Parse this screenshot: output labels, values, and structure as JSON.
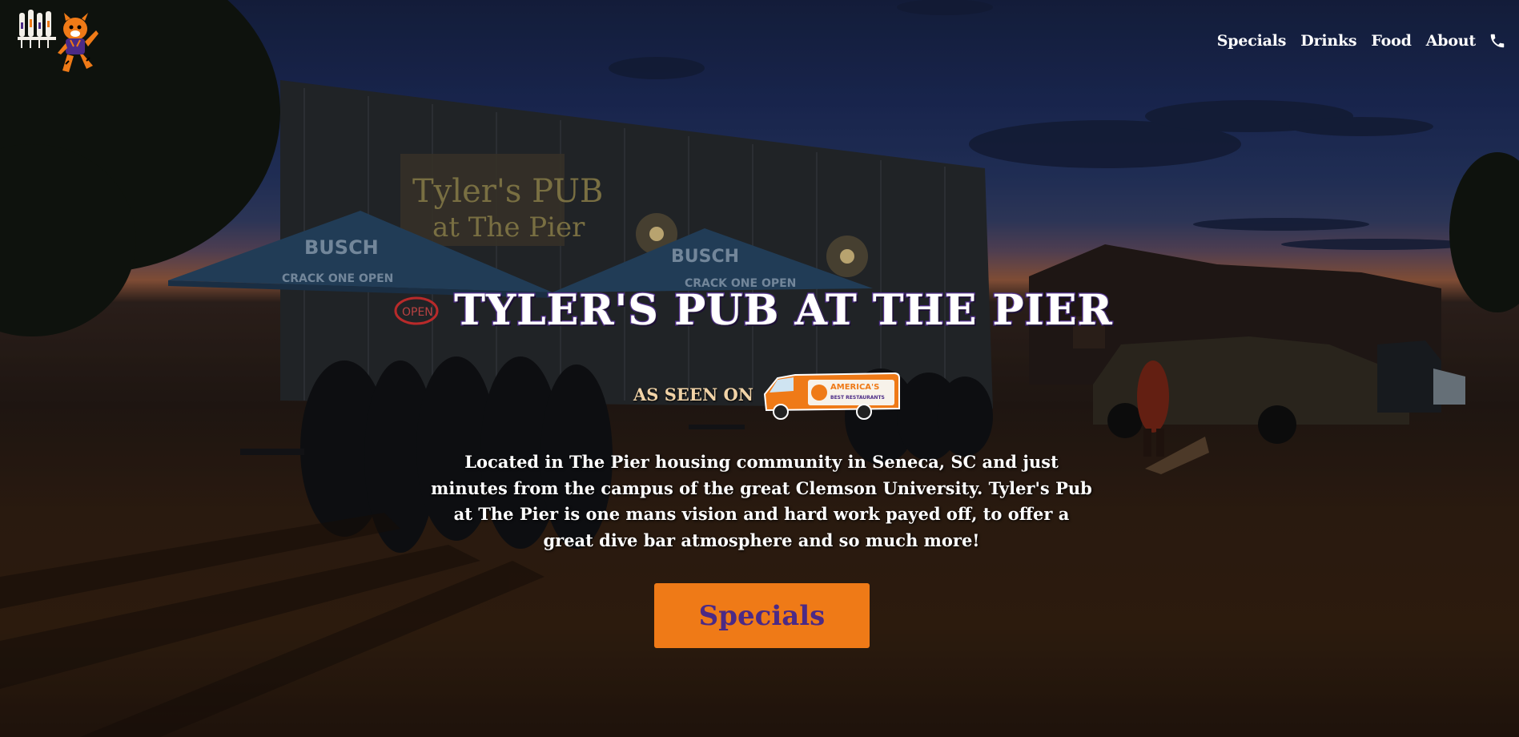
{
  "brand": {
    "logo_icon": "tiger-mascot-with-beer-taps-logo",
    "accent_orange": "#ef7a17",
    "accent_purple": "#4b2a86"
  },
  "nav": {
    "items": [
      {
        "label": "Specials"
      },
      {
        "label": "Drinks"
      },
      {
        "label": "Food"
      },
      {
        "label": "About"
      }
    ],
    "phone_icon": "phone-icon"
  },
  "hero": {
    "title": "TYLER'S PUB AT THE PIER",
    "seen_on_label": "AS SEEN ON",
    "seen_on_logo_text_1": "AMERICA'S",
    "seen_on_logo_text_2": "BEST RESTAURANTS",
    "description": "Located in The Pier housing community in Seneca, SC and just minutes from the campus of the great Clemson University. Tyler's Pub at The Pier is one mans vision and hard work payed off, to offer a great dive bar atmosphere and so much more!",
    "cta_label": "Specials"
  },
  "background": {
    "sign_text_1": "Tyler's PUB",
    "sign_text_2": "at The Pier",
    "umbrella_text_1": "BUSCH",
    "umbrella_text_2": "CRACK ONE OPEN",
    "neon_text": "OPEN"
  }
}
